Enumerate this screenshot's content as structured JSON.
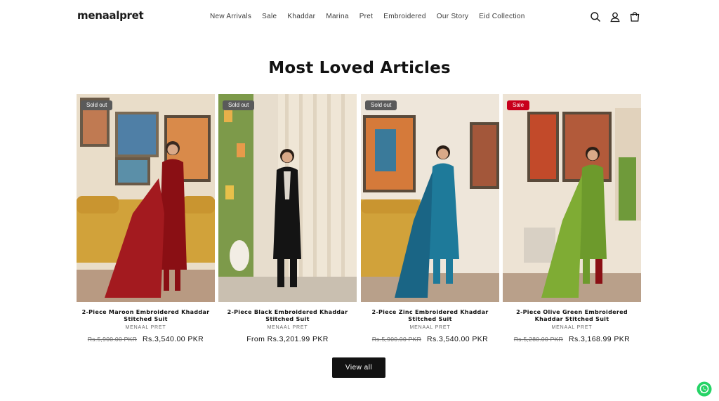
{
  "header": {
    "logo": "menaalpret",
    "nav": [
      "New Arrivals",
      "Sale",
      "Khaddar",
      "Marina",
      "Pret",
      "Embroidered",
      "Our Story",
      "Eid Collection"
    ],
    "icons": [
      "search-icon",
      "account-icon",
      "cart-icon"
    ]
  },
  "section": {
    "title": "Most Loved Articles",
    "view_all": "View all"
  },
  "products": [
    {
      "badge": "Sold out",
      "badge_type": "sold",
      "title": "2-Piece Maroon Embroidered Khaddar Stitched Suit",
      "vendor": "MENAAL PRET",
      "price_old": "Rs.5,900.00 PKR",
      "price": "Rs.3,540.00 PKR",
      "dress_color": "#8a0f14"
    },
    {
      "badge": "Sold out",
      "badge_type": "sold",
      "title": "2-Piece Black Embroidered Khaddar Stitched Suit",
      "vendor": "MENAAL PRET",
      "price_old": "",
      "price": "From Rs.3,201.99 PKR",
      "dress_color": "#141414"
    },
    {
      "badge": "Sold out",
      "badge_type": "sold",
      "title": "2-Piece Zinc Embroidered Khaddar Stitched Suit",
      "vendor": "MENAAL PRET",
      "price_old": "Rs.5,900.00 PKR",
      "price": "Rs.3,540.00 PKR",
      "dress_color": "#1e7a9a"
    },
    {
      "badge": "Sale",
      "badge_type": "sale",
      "title": "2-Piece Olive Green Embroidered Khaddar Stitched Suit",
      "vendor": "MENAAL PRET",
      "price_old": "Rs.5,280.00 PKR",
      "price": "Rs.3,168.99 PKR",
      "dress_color": "#6d9a2c"
    }
  ],
  "floating": {
    "icon": "whatsapp-icon",
    "color": "#25d366"
  }
}
